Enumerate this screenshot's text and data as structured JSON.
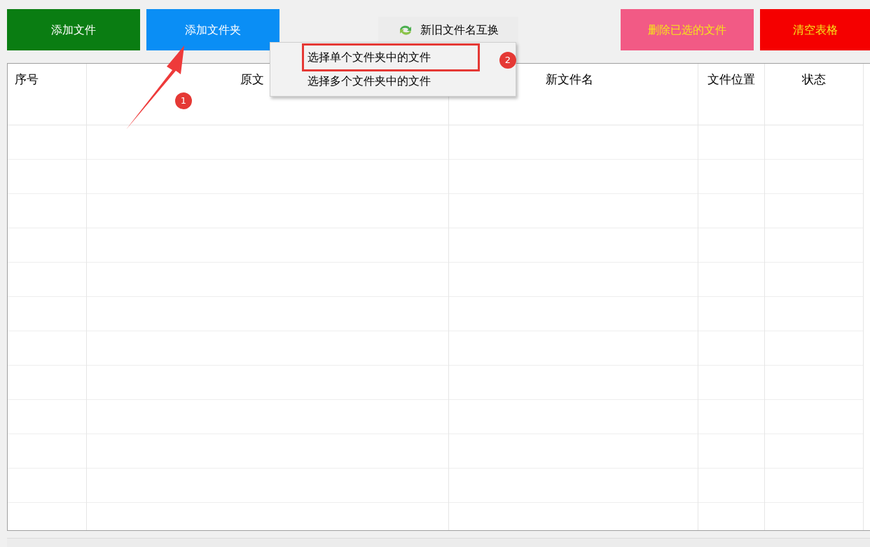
{
  "toolbar": [
    {
      "label": "添加文件",
      "kind": "green"
    },
    {
      "label": "添加文件夹",
      "kind": "blue"
    },
    {
      "label": "新旧文件名互换",
      "kind": "swap"
    },
    {
      "label": "删除已选的文件",
      "kind": "pink"
    },
    {
      "label": "清空表格",
      "kind": "red"
    }
  ],
  "table": {
    "columns": [
      "序号",
      "原文",
      "新文件名",
      "文件位置",
      "状态"
    ]
  },
  "menu": {
    "items": [
      {
        "label": "选择单个文件夹中的文件",
        "highlighted": true
      },
      {
        "label": "选择多个文件夹中的文件",
        "highlighted": false
      }
    ]
  },
  "annotations": [
    "1",
    "2"
  ]
}
